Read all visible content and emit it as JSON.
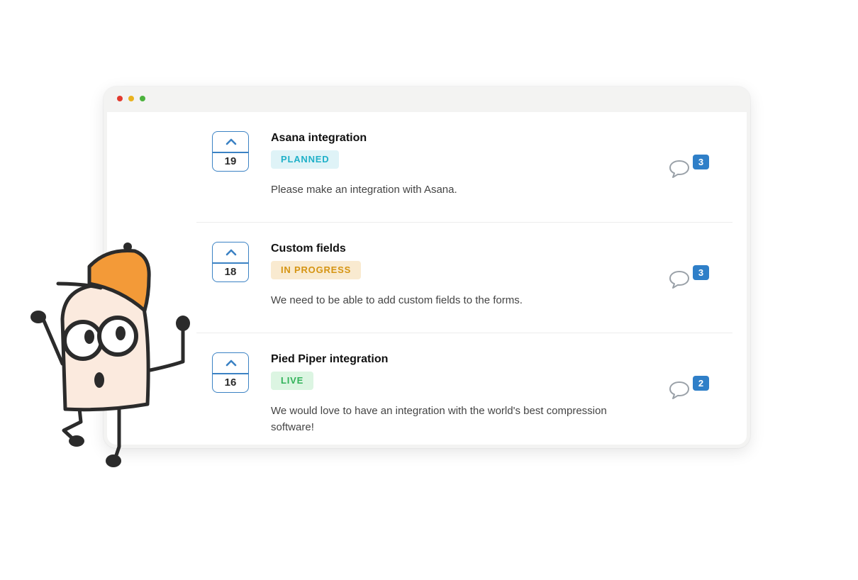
{
  "window": {
    "traffic_lights": [
      "#e23a2f",
      "#e9b21f",
      "#4cb23d"
    ]
  },
  "colors": {
    "accent": "#3b82c4",
    "comment_badge": "#2f7fc8",
    "mascot_hat": "#f39a38",
    "mascot_body": "#fbeade"
  },
  "posts": [
    {
      "votes": "19",
      "title": "Asana integration",
      "status": "PLANNED",
      "description": "Please make an integration with Asana.",
      "comments": "3"
    },
    {
      "votes": "18",
      "title": "Custom fields",
      "status": "IN PROGRESS",
      "description": "We need to be able to add custom fields to the forms.",
      "comments": "3"
    },
    {
      "votes": "16",
      "title": "Pied Piper integration",
      "status": "LIVE",
      "description": "We would love to have an integration with the world's best compression software!",
      "comments": "2"
    }
  ],
  "icons": {
    "upvote": "chevron-up-icon",
    "comment": "speech-bubble-icon"
  }
}
